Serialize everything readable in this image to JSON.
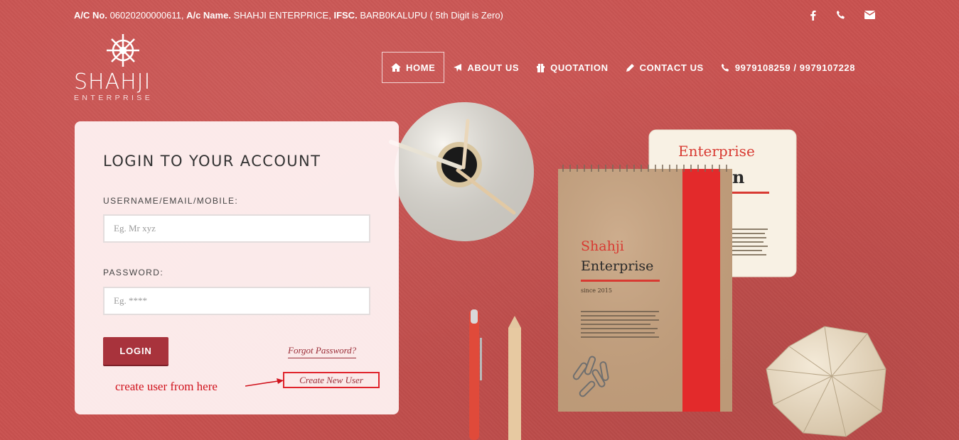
{
  "topbar": {
    "acno_label": "A/C No.",
    "acno_value": "06020200000611,",
    "acname_label": "A/c Name.",
    "acname_value": "SHAHJI ENTERPRICE,",
    "ifsc_label": "IFSC.",
    "ifsc_value": "BARB0KALUPU ( 5th Digit is Zero)",
    "icons": [
      "facebook-icon",
      "phone-icon",
      "envelope-icon"
    ]
  },
  "logo": {
    "name": "SHAHJI",
    "sub": "ENTERPRISE"
  },
  "nav": {
    "items": [
      {
        "label": "HOME",
        "icon": "home-icon",
        "active": true
      },
      {
        "label": "ABOUT US",
        "icon": "plane-icon",
        "active": false
      },
      {
        "label": "QUOTATION",
        "icon": "gift-icon",
        "active": false
      },
      {
        "label": "CONTACT US",
        "icon": "pencil-icon",
        "active": false
      },
      {
        "label": "9979108259 / 9979107228",
        "icon": "phone-icon",
        "active": false
      }
    ]
  },
  "login": {
    "title": "LOGIN TO YOUR ACCOUNT",
    "username_label": "USERNAME/EMAIL/MOBILE:",
    "username_placeholder": "Eg. Mr xyz",
    "username_value": "",
    "password_label": "PASSWORD:",
    "password_placeholder": "Eg. ****",
    "password_value": "",
    "login_button": "LOGIN",
    "forgot_link": "Forgot Password?",
    "create_user_link": "Create New User"
  },
  "annotation": {
    "text": "create user from here",
    "color": "#d0121c"
  },
  "scene": {
    "notebook_line1": "Shahji",
    "notebook_line2": "Enterprise",
    "notebook_since": "since 2015",
    "card_title": "Enterprise",
    "card_partial": "n"
  },
  "colors": {
    "background": "#c9514f",
    "accent": "#a8333c",
    "link": "#9a2c36",
    "annotation_box": "#e0242c"
  }
}
